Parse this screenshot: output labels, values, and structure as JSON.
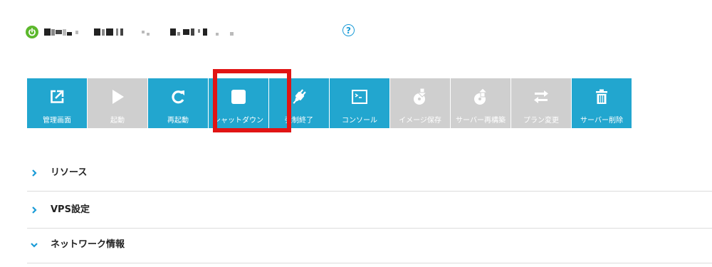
{
  "header": {
    "status_icon": "power-icon",
    "status_color": "#5cb82c",
    "help_icon": "question-circle-icon",
    "help_label": "?"
  },
  "toolbar": {
    "accent": "#22a6cf",
    "disabled_color": "#cfcfcf",
    "highlight_color": "#e11414",
    "highlighted": "shutdown",
    "buttons": [
      {
        "id": "manage",
        "label": "管理画面",
        "icon": "external-link-icon",
        "enabled": true
      },
      {
        "id": "start",
        "label": "起動",
        "icon": "play-icon",
        "enabled": false
      },
      {
        "id": "restart",
        "label": "再起動",
        "icon": "restart-icon",
        "enabled": true
      },
      {
        "id": "shutdown",
        "label": "シャットダウン",
        "icon": "stop-icon",
        "enabled": true
      },
      {
        "id": "force-stop",
        "label": "強制終了",
        "icon": "plug-icon",
        "enabled": true
      },
      {
        "id": "console",
        "label": "コンソール",
        "icon": "console-icon",
        "enabled": true
      },
      {
        "id": "image-save",
        "label": "イメージ保存",
        "icon": "disk-download-icon",
        "enabled": false
      },
      {
        "id": "rebuild",
        "label": "サーバー再構築",
        "icon": "disk-upload-icon",
        "enabled": false
      },
      {
        "id": "plan-change",
        "label": "プラン変更",
        "icon": "swap-arrows-icon",
        "enabled": false
      },
      {
        "id": "delete",
        "label": "サーバー削除",
        "icon": "trash-icon",
        "enabled": true
      }
    ]
  },
  "sections": [
    {
      "title": "リソース",
      "expanded": false
    },
    {
      "title": "VPS設定",
      "expanded": false
    },
    {
      "title": "ネットワーク情報",
      "expanded": true
    }
  ]
}
